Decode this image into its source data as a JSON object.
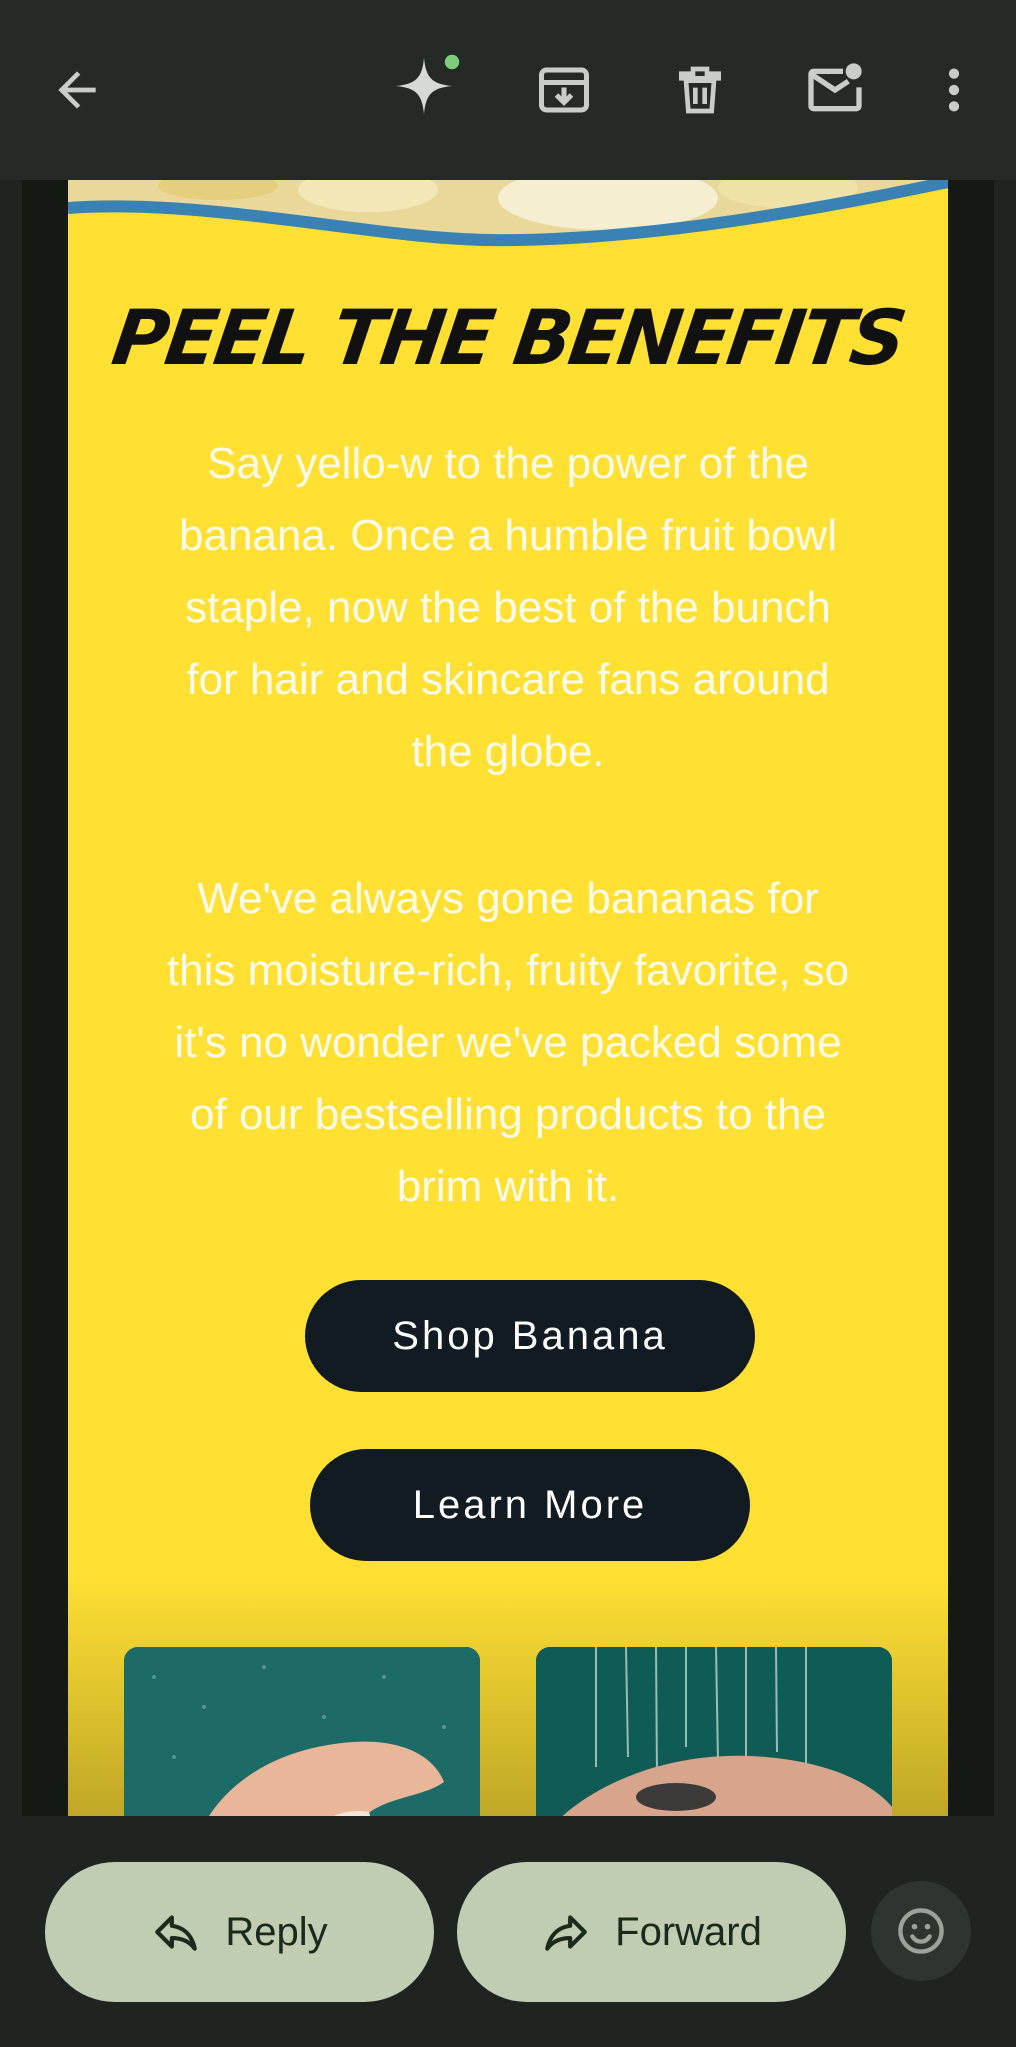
{
  "toolbar": {
    "back_icon": "arrow-back-icon",
    "ai_icon": "sparkle-icon",
    "archive_icon": "archive-icon",
    "delete_icon": "trash-icon",
    "unread_icon": "mail-unread-icon",
    "more_icon": "more-vert-icon",
    "accent_dot_color": "#7ccf7a"
  },
  "email": {
    "headline": "PEEL THE BENEFITS",
    "paragraph1": "Say yello-w to the power of the banana. Once a humble fruit bowl staple, now the best of the bunch for hair and skincare fans around the globe.",
    "paragraph2": "We've always gone bananas for this moisture-rich, fruity favorite, so it's no wonder we've packed some of our bestselling products to the brim with it.",
    "primary_button": "Shop Banana",
    "secondary_button": "Learn More",
    "colors": {
      "card_background": "#ffe033",
      "button_background": "#121a22",
      "wave_stripe": "#3a82b4"
    }
  },
  "actions": {
    "reply_label": "Reply",
    "forward_label": "Forward",
    "reply_icon": "reply-icon",
    "forward_icon": "forward-icon",
    "emoji_icon": "emoji-icon",
    "button_color": "#c0cdb2"
  }
}
